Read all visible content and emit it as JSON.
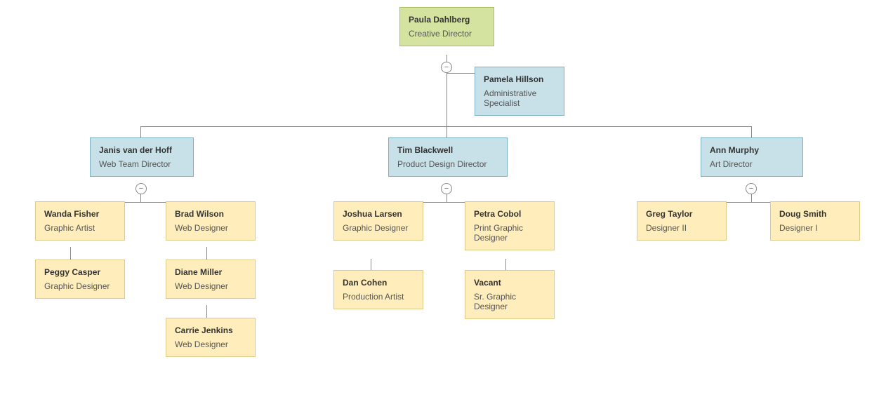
{
  "nodes": {
    "paula": {
      "name": "Paula Dahlberg",
      "title": "Creative Director",
      "color": "green"
    },
    "pamela": {
      "name": "Pamela Hillson",
      "title": "Administrative Specialist",
      "color": "blue"
    },
    "janis": {
      "name": "Janis van der Hoff",
      "title": "Web Team Director",
      "color": "blue"
    },
    "tim": {
      "name": "Tim Blackwell",
      "title": "Product Design Director",
      "color": "blue"
    },
    "ann": {
      "name": "Ann Murphy",
      "title": "Art Director",
      "color": "blue"
    },
    "wanda": {
      "name": "Wanda Fisher",
      "title": "Graphic Artist",
      "color": "yellow"
    },
    "brad": {
      "name": "Brad Wilson",
      "title": "Web Designer",
      "color": "yellow"
    },
    "peggy": {
      "name": "Peggy Casper",
      "title": "Graphic Designer",
      "color": "yellow"
    },
    "diane": {
      "name": "Diane Miller",
      "title": "Web Designer",
      "color": "yellow"
    },
    "carrie": {
      "name": "Carrie Jenkins",
      "title": "Web Designer",
      "color": "yellow"
    },
    "joshua": {
      "name": "Joshua Larsen",
      "title": "Graphic Designer",
      "color": "yellow"
    },
    "petra": {
      "name": "Petra Cobol",
      "title": "Print Graphic Designer",
      "color": "yellow"
    },
    "dan": {
      "name": "Dan Cohen",
      "title": "Production Artist",
      "color": "yellow"
    },
    "vacant": {
      "name": "Vacant",
      "title": "Sr. Graphic Designer",
      "color": "yellow"
    },
    "greg": {
      "name": "Greg Taylor",
      "title": "Designer II",
      "color": "yellow"
    },
    "doug": {
      "name": "Doug Smith",
      "title": "Designer I",
      "color": "yellow"
    }
  }
}
